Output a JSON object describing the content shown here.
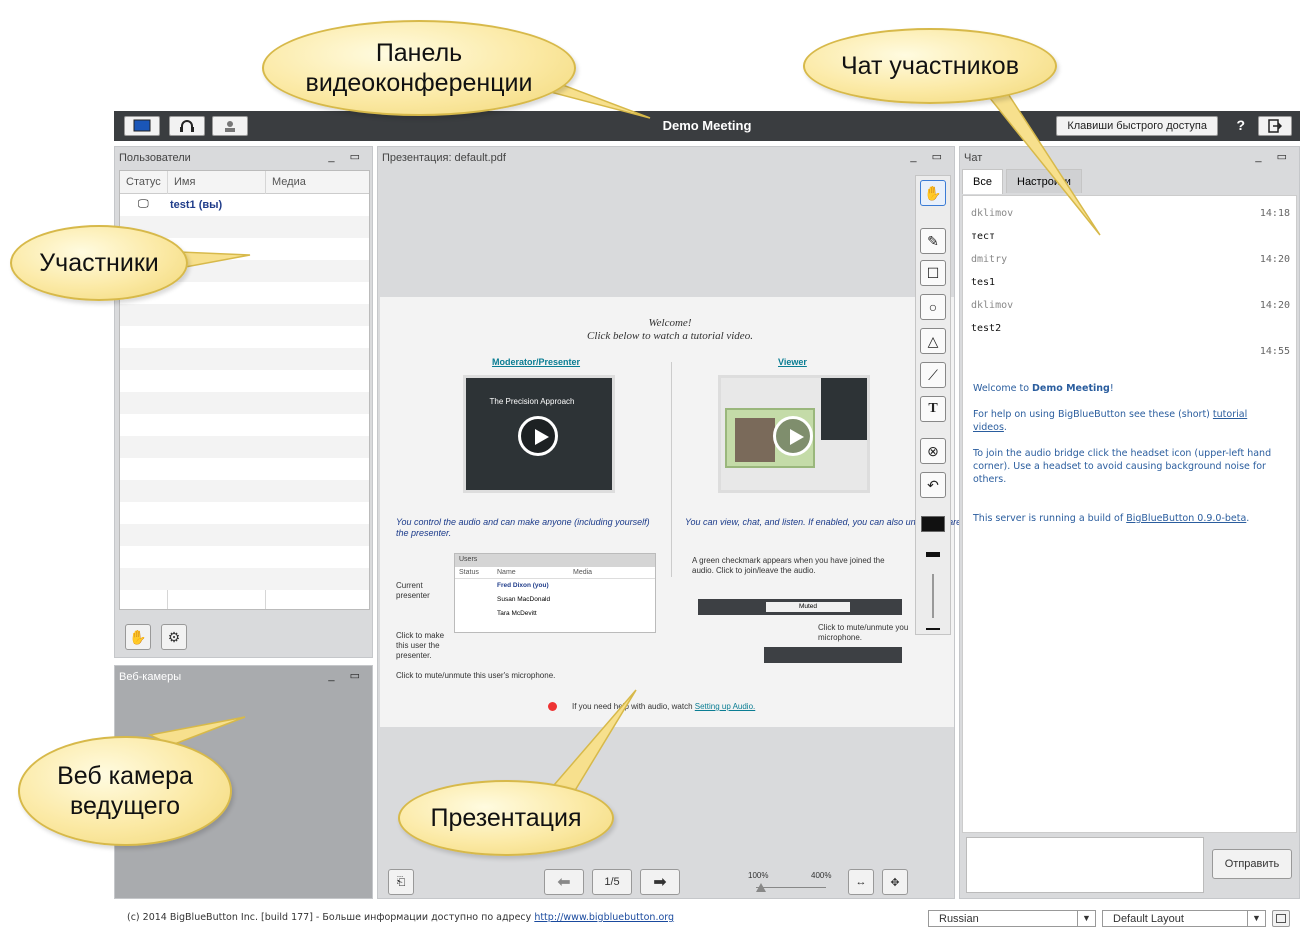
{
  "topbar": {
    "title": "Demo Meeting",
    "shortcuts_label": "Клавиши быстрого доступа",
    "help_label": "?"
  },
  "users_panel": {
    "title": "Пользователи",
    "columns": [
      "Статус",
      "Имя",
      "Медиа"
    ],
    "users": [
      {
        "name": "test1 (вы)"
      }
    ]
  },
  "webcams_panel": {
    "title": "Веб-камеры"
  },
  "presentation": {
    "title": "Презентация: default.pdf",
    "page": "1/5",
    "zoom_min": "100%",
    "zoom_max": "400%",
    "slide": {
      "welcome": "Welcome!",
      "subtitle": "Click below to watch a tutorial video.",
      "moderator_link": "Moderator/Presenter",
      "viewer_link": "Viewer",
      "thumb_title": "The Precision Approach",
      "mod_text": "You control the audio and can make anyone (including yourself) the presenter.",
      "viewer_text": "You can view, chat, and listen.  If enabled, you can also unr and share your webcam..",
      "mini_users_title": "Users",
      "mini_cols": [
        "Status",
        "Name",
        "Media"
      ],
      "mini_users": [
        "Fred Dixon (you)",
        "Susan MacDonald",
        "Tara McDevitt"
      ],
      "current_presenter": "Current presenter",
      "click_make": "Click to make this user the presenter.",
      "click_mute": "Click to mute/unmute this user's microphone.",
      "green_check": "A green checkmark appears when you have joined the audio.  Click to join/leave the audio.",
      "muted": "Muted",
      "click_mute_you": "Click to mute/unmute you microphone.",
      "audio_help": "If you need help with audio, watch",
      "audio_link": "Setting up Audio."
    }
  },
  "chat": {
    "title": "Чат",
    "tabs": [
      "Все",
      "Настройки"
    ],
    "messages": [
      {
        "name": "dklimov",
        "time": "14:18",
        "text": "тест"
      },
      {
        "name": "dmitry",
        "time": "14:20",
        "text": "tes1"
      },
      {
        "name": "dklimov",
        "time": "14:20",
        "text": "test2"
      },
      {
        "name": "",
        "time": "14:55",
        "text": ""
      }
    ],
    "welcome_pre": "Welcome to ",
    "welcome_bold": "Demo Meeting",
    "welcome_post": "!",
    "help_pre": "For help on using BigBlueButton see these (short) ",
    "help_link": "tutorial videos",
    "help_post": ".",
    "audio_msg": "To join the audio bridge click the headset icon (upper-left hand corner).  Use a headset to avoid causing background noise for others.",
    "server_pre": "This server is running a build of ",
    "server_link": "BigBlueButton 0.9.0-beta",
    "server_post": ".",
    "send_label": "Отправить"
  },
  "footer": {
    "text": "(c) 2014 BigBlueButton Inc. [build 177] - Больше информации доступно по адресу ",
    "link": "http://www.bigbluebutton.org",
    "language": "Russian",
    "layout": "Default Layout"
  },
  "callouts": {
    "video_panel": "Панель видеоконференции",
    "chat": "Чат участников",
    "participants": "Участники",
    "webcam": "Веб камера ведущего",
    "presentation": "Презентация"
  },
  "colors": {
    "topbar": "#3a3d40",
    "panel": "#d9dadc",
    "link": "#0a7d93",
    "callout": "#fbe9a4"
  }
}
